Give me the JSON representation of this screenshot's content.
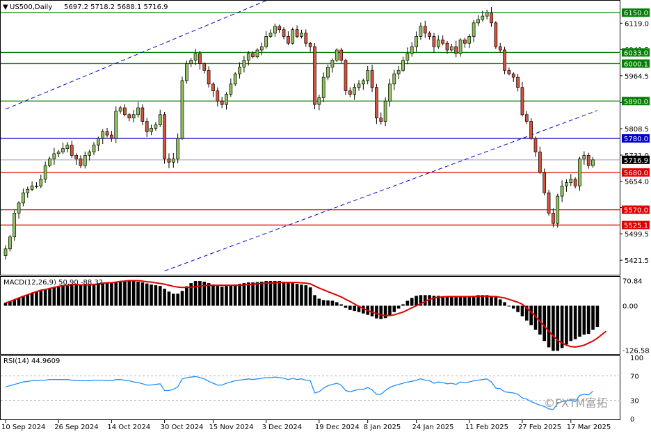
{
  "chart_data": {
    "type": "candlestick",
    "symbol_label": "US500,Daily",
    "ohlc_label": "5697.2 5718.2 5688.1 5716.9",
    "price_axis_ticks": [
      "6119.0",
      "6041.5",
      "5964.5",
      "5886.0",
      "5808.5",
      "5731.0",
      "5654.0",
      "5576.5",
      "5499.5",
      "5421.5"
    ],
    "price_range": [
      5385,
      6175
    ],
    "x_labels": [
      {
        "bar": 0,
        "text": "10 Sep 2024"
      },
      {
        "bar": 12,
        "text": "26 Sep 2024"
      },
      {
        "bar": 24,
        "text": "14 Oct 2024"
      },
      {
        "bar": 36,
        "text": "30 Oct 2024"
      },
      {
        "bar": 47,
        "text": "15 Nov 2024"
      },
      {
        "bar": 59,
        "text": "3 Dec 2024"
      },
      {
        "bar": 71,
        "text": "19 Dec 2024"
      },
      {
        "bar": 82,
        "text": "8 Jan 2025"
      },
      {
        "bar": 93,
        "text": "24 Jan 2025"
      },
      {
        "bar": 105,
        "text": "11 Feb 2025"
      },
      {
        "bar": 117,
        "text": "27 Feb 2025"
      },
      {
        "bar": 128,
        "text": "17 Mar 2025"
      }
    ],
    "levels": [
      {
        "price": 6150.0,
        "label": "6150.0",
        "color": "#008000"
      },
      {
        "price": 6033.0,
        "label": "6033.0",
        "color": "#008000"
      },
      {
        "price": 6000.1,
        "label": "6000.1",
        "color": "#008000"
      },
      {
        "price": 5890.0,
        "label": "5890.0",
        "color": "#008000"
      },
      {
        "price": 5780.0,
        "label": "5780.0",
        "color": "#0000cc"
      },
      {
        "price": 5716.9,
        "label": "5716.9",
        "color": "#000000",
        "kind": "last"
      },
      {
        "price": 5680.0,
        "label": "5680.0",
        "color": "#dd0000"
      },
      {
        "price": 5570.0,
        "label": "5570.0",
        "color": "#dd0000"
      },
      {
        "price": 5525.1,
        "label": "5525.1",
        "color": "#dd0000"
      }
    ],
    "channel": {
      "color": "#0000cc",
      "lines": [
        {
          "start": {
            "bar": 0,
            "price": 5866
          },
          "end": {
            "bar": 68,
            "price": 6234
          }
        },
        {
          "start": {
            "bar": 36,
            "price": 5390
          },
          "end": {
            "bar": 134,
            "price": 5862
          }
        }
      ]
    },
    "up_color": "#8fc25a",
    "down_color": "#d9533a",
    "close_series": [
      5455,
      5490,
      5560,
      5590,
      5620,
      5630,
      5640,
      5640,
      5660,
      5700,
      5720,
      5735,
      5740,
      5750,
      5760,
      5730,
      5720,
      5700,
      5730,
      5740,
      5760,
      5780,
      5800,
      5790,
      5780,
      5860,
      5870,
      5850,
      5840,
      5850,
      5870,
      5830,
      5800,
      5810,
      5820,
      5850,
      5720,
      5710,
      5720,
      5780,
      5950,
      6000,
      6010,
      6030,
      6000,
      5980,
      5940,
      5920,
      5890,
      5880,
      5910,
      5940,
      5970,
      5990,
      6010,
      6030,
      6020,
      6040,
      6050,
      6080,
      6090,
      6110,
      6100,
      6080,
      6060,
      6100,
      6080,
      6090,
      6060,
      6050,
      5880,
      5900,
      5960,
      5990,
      6010,
      6040,
      6010,
      5920,
      5910,
      5930,
      5940,
      5950,
      5980,
      5930,
      5840,
      5830,
      5890,
      5940,
      5970,
      5980,
      6010,
      6030,
      6050,
      6080,
      6110,
      6090,
      6080,
      6050,
      6070,
      6060,
      6040,
      6050,
      6030,
      6070,
      6060,
      6080,
      6120,
      6130,
      6140,
      6150,
      6120,
      6050,
      6040,
      5980,
      5970,
      5960,
      5930,
      5850,
      5830,
      5780,
      5740,
      5680,
      5620,
      5560,
      5530,
      5610,
      5640,
      5650,
      5660,
      5640,
      5720,
      5730,
      5700,
      5716.9
    ],
    "macd": {
      "label": "MACD(12,26,9) 50.90 -88.32",
      "ticks": [
        "70.84",
        "0.00",
        "-126.58"
      ],
      "range": [
        -135,
        78
      ],
      "histogram": [
        8,
        12,
        17,
        22,
        27,
        31,
        36,
        40,
        44,
        46,
        49,
        52,
        55,
        57,
        58,
        60,
        60,
        59,
        59,
        59,
        60,
        62,
        64,
        65,
        65,
        68,
        70,
        70,
        70,
        69,
        68,
        66,
        63,
        60,
        58,
        56,
        48,
        40,
        34,
        34,
        42,
        55,
        64,
        70,
        70,
        68,
        64,
        60,
        56,
        54,
        56,
        58,
        60,
        62,
        64,
        66,
        66,
        67,
        68,
        70,
        70,
        70,
        70,
        68,
        66,
        65,
        62,
        60,
        58,
        52,
        30,
        20,
        16,
        15,
        14,
        10,
        4,
        -6,
        -12,
        -15,
        -18,
        -22,
        -26,
        -30,
        -36,
        -38,
        -35,
        -28,
        -18,
        -8,
        4,
        14,
        22,
        28,
        30,
        30,
        30,
        28,
        28,
        27,
        26,
        25,
        24,
        25,
        25,
        26,
        28,
        30,
        30,
        30,
        28,
        24,
        18,
        10,
        0,
        -8,
        -18,
        -30,
        -42,
        -55,
        -68,
        -82,
        -100,
        -118,
        -128,
        -128,
        -120,
        -110,
        -100,
        -95,
        -88,
        -82,
        -80,
        -68,
        -60
      ],
      "signal": [
        8,
        12,
        17,
        22,
        27,
        31,
        36,
        40,
        44,
        46,
        49,
        52,
        55,
        57,
        58,
        60,
        60,
        59,
        59,
        59,
        60,
        62,
        64,
        65,
        65,
        67,
        69,
        70,
        71,
        71,
        71,
        70,
        68,
        67,
        65,
        63,
        61,
        58,
        55,
        53,
        52,
        52,
        53,
        54,
        56,
        57,
        58,
        58,
        58,
        58,
        58,
        58,
        58,
        58,
        59,
        60,
        61,
        62,
        63,
        64,
        64,
        65,
        66,
        66,
        66,
        66,
        66,
        65,
        64,
        62,
        56,
        50,
        45,
        40,
        35,
        30,
        25,
        18,
        12,
        5,
        -2,
        -8,
        -14,
        -18,
        -22,
        -26,
        -28,
        -28,
        -26,
        -22,
        -18,
        -12,
        -6,
        0,
        6,
        12,
        18,
        22,
        24,
        25,
        26,
        26,
        26,
        26,
        26,
        26,
        26,
        27,
        27,
        27,
        26,
        26,
        24,
        22,
        18,
        14,
        10,
        4,
        -6,
        -18,
        -30,
        -44,
        -58,
        -72,
        -86,
        -98,
        -106,
        -112,
        -116,
        -117,
        -115,
        -112,
        -106,
        -100,
        -92,
        -82,
        -72
      ]
    },
    "rsi": {
      "label": "RSI(14) 44.9609",
      "ticks": [
        "100",
        "70",
        "30",
        "0"
      ],
      "range": [
        0,
        100
      ],
      "values": [
        52,
        54,
        56,
        58,
        60,
        61,
        62,
        62,
        63,
        63,
        64,
        64,
        64,
        64,
        64,
        63,
        62,
        62,
        62,
        62,
        63,
        63,
        63,
        62,
        62,
        64,
        64,
        63,
        62,
        60,
        59,
        57,
        55,
        55,
        56,
        57,
        46,
        46,
        48,
        52,
        65,
        67,
        68,
        69,
        67,
        65,
        61,
        58,
        55,
        55,
        58,
        60,
        62,
        63,
        64,
        65,
        64,
        65,
        66,
        67,
        67,
        68,
        67,
        66,
        64,
        66,
        64,
        65,
        63,
        62,
        42,
        44,
        50,
        54,
        56,
        58,
        55,
        46,
        44,
        46,
        48,
        48,
        51,
        47,
        40,
        40,
        46,
        51,
        54,
        56,
        58,
        60,
        61,
        63,
        65,
        63,
        62,
        58,
        60,
        59,
        57,
        58,
        56,
        60,
        59,
        60,
        62,
        63,
        64,
        65,
        60,
        50,
        49,
        44,
        43,
        42,
        40,
        34,
        32,
        28,
        25,
        22,
        20,
        16,
        15,
        25,
        28,
        29,
        30,
        28,
        38,
        40,
        39,
        44.96
      ]
    }
  },
  "watermark": "©FXTM富拓"
}
